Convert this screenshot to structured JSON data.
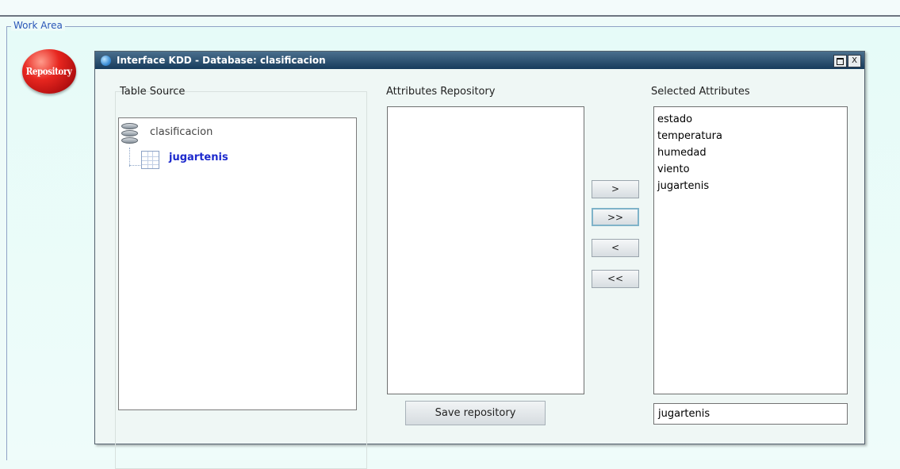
{
  "work_area": {
    "label": "Work Area"
  },
  "repository_icon": {
    "label": "Repository",
    "icon": "repository-icon"
  },
  "window": {
    "title": "Interface KDD - Database: clasificacion",
    "controls": [
      "maximize",
      "close"
    ],
    "close_label": "X"
  },
  "table_source": {
    "label": "Table Source",
    "database": {
      "name": "clasificacion",
      "icon": "database-icon"
    },
    "table": {
      "name": "jugartenis",
      "icon": "table-icon"
    }
  },
  "attributes_repository": {
    "label": "Attributes Repository",
    "items": [],
    "save_label": "Save repository"
  },
  "move_buttons": {
    "move_one_right": ">",
    "move_all_right": ">>",
    "move_one_left": "<",
    "move_all_left": "<<"
  },
  "selected_attributes": {
    "label": "Selected Attributes",
    "items": [
      "estado",
      "temperatura",
      "humedad",
      "viento",
      "jugartenis"
    ],
    "target_value": "jugartenis"
  },
  "colors": {
    "titlebar": "#173b5c",
    "table_name": "#1c29cd",
    "work_area_label": "#2a56b8",
    "repository_icon": "#e7261f"
  }
}
